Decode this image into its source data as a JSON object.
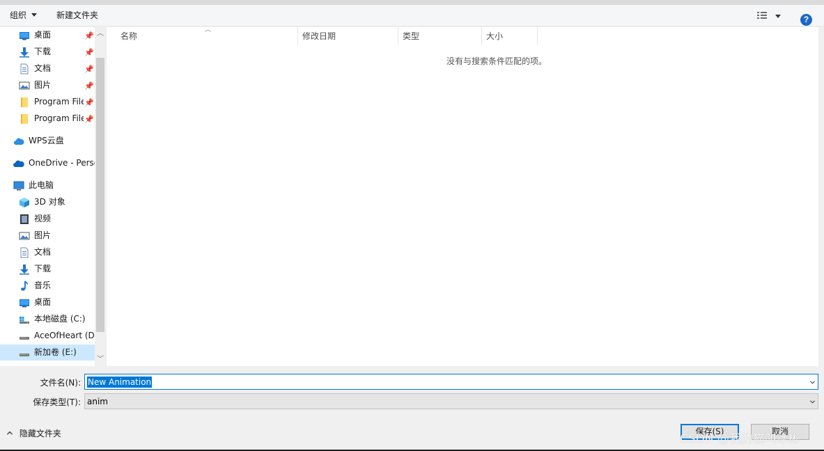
{
  "toolbar": {
    "organize_label": "组织",
    "new_folder_label": "新建文件夹",
    "help_label": "?"
  },
  "nav": {
    "quick_access": [
      {
        "label": "桌面",
        "icon": "desktop-icon",
        "pinned": true
      },
      {
        "label": "下载",
        "icon": "download-icon",
        "pinned": true
      },
      {
        "label": "文档",
        "icon": "document-icon",
        "pinned": true
      },
      {
        "label": "图片",
        "icon": "picture-icon",
        "pinned": true
      },
      {
        "label": "Program Files",
        "icon": "folder-icon",
        "pinned": true
      },
      {
        "label": "Program Files",
        "icon": "folder-icon",
        "pinned": true
      }
    ],
    "wps_cloud": "WPS云盘",
    "onedrive": "OneDrive - Personal",
    "this_pc": "此电脑",
    "pc_items": [
      {
        "label": "3D 对象",
        "icon": "3d-objects-icon"
      },
      {
        "label": "视频",
        "icon": "video-icon"
      },
      {
        "label": "图片",
        "icon": "picture-icon"
      },
      {
        "label": "文档",
        "icon": "document-icon"
      },
      {
        "label": "下载",
        "icon": "download-icon"
      },
      {
        "label": "音乐",
        "icon": "music-icon"
      },
      {
        "label": "桌面",
        "icon": "desktop-icon"
      },
      {
        "label": "本地磁盘 (C:)",
        "icon": "system-drive-icon"
      },
      {
        "label": "AceOfHeart (D:)",
        "icon": "drive-icon"
      },
      {
        "label": "新加卷 (E:)",
        "icon": "drive-icon",
        "selected": true
      }
    ]
  },
  "columns": {
    "name": "名称",
    "modified": "修改日期",
    "type": "类型",
    "size": "大小"
  },
  "empty_message": "没有与搜索条件匹配的项。",
  "form": {
    "filename_label": "文件名(N):",
    "filename_value": "New Animation",
    "filetype_label": "保存类型(T):",
    "filetype_value": "anim"
  },
  "footer": {
    "hide_folders_label": "隐藏文件夹",
    "save_label": "保存(S)",
    "cancel_label": "取消",
    "watermark": "CSDN @我的猫叫冰彬"
  },
  "colors": {
    "accent": "#0078d7",
    "selection": "#cce8ff",
    "help": "#1b67c9"
  }
}
